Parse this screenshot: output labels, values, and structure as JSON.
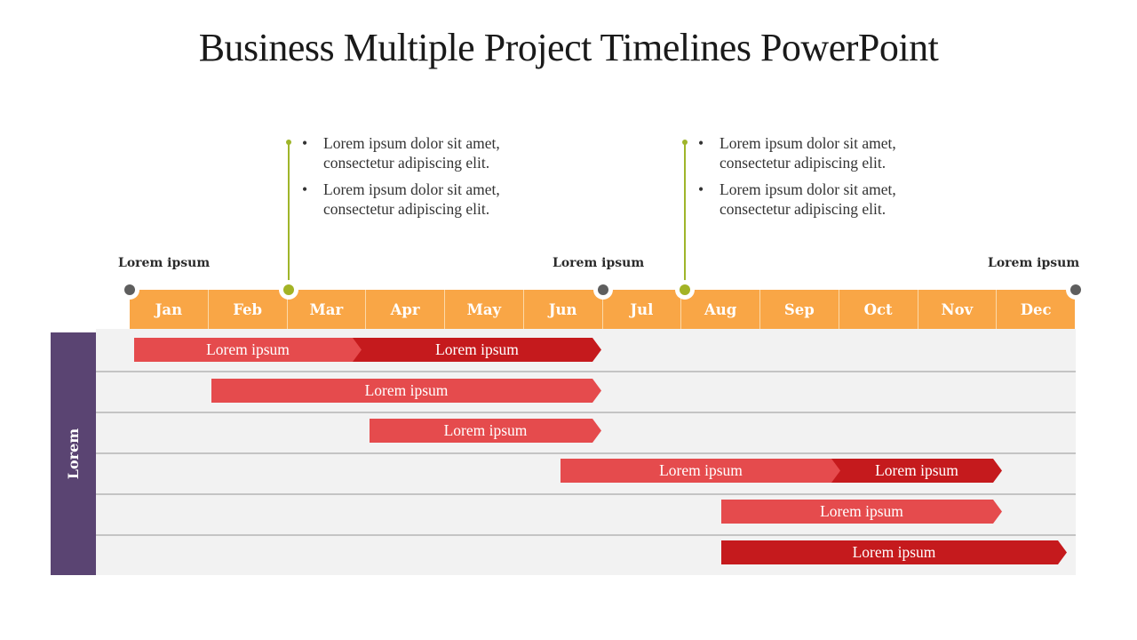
{
  "title": "Business Multiple Project Timelines PowerPoint",
  "callouts": [
    {
      "bullets": [
        "Lorem ipsum dolor sit amet, consectetur adipiscing elit.",
        "Lorem ipsum dolor sit amet, consectetur adipiscing elit."
      ]
    },
    {
      "bullets": [
        "Lorem ipsum dolor sit amet, consectetur adipiscing elit.",
        "Lorem ipsum dolor sit amet, consectetur adipiscing elit."
      ]
    }
  ],
  "milestone_labels": [
    "Lorem ipsum",
    "Lorem ipsum",
    "Lorem ipsum"
  ],
  "months": [
    "Jan",
    "Feb",
    "Mar",
    "Apr",
    "May",
    "Jun",
    "Jul",
    "Aug",
    "Sep",
    "Oct",
    "Nov",
    "Dec"
  ],
  "sidebar_label": "Lorem",
  "colors": {
    "month_strip": "#f9a646",
    "bar_light": "#e54b4d",
    "bar_dark": "#c51a1d",
    "sidebar": "#5a4472",
    "milestone_gray": "#5e5e5e",
    "milestone_green": "#a3b325"
  },
  "rows": [
    {
      "bars": [
        {
          "label": "Lorem ipsum",
          "tone": "light"
        },
        {
          "label": "Lorem ipsum",
          "tone": "dark"
        }
      ]
    },
    {
      "bars": [
        {
          "label": "Lorem ipsum",
          "tone": "light"
        }
      ]
    },
    {
      "bars": [
        {
          "label": "Lorem ipsum",
          "tone": "light"
        }
      ]
    },
    {
      "bars": [
        {
          "label": "Lorem ipsum",
          "tone": "light"
        },
        {
          "label": "Lorem ipsum",
          "tone": "dark"
        }
      ]
    },
    {
      "bars": [
        {
          "label": "Lorem ipsum",
          "tone": "light"
        }
      ]
    },
    {
      "bars": [
        {
          "label": "Lorem ipsum",
          "tone": "dark"
        }
      ]
    }
  ]
}
